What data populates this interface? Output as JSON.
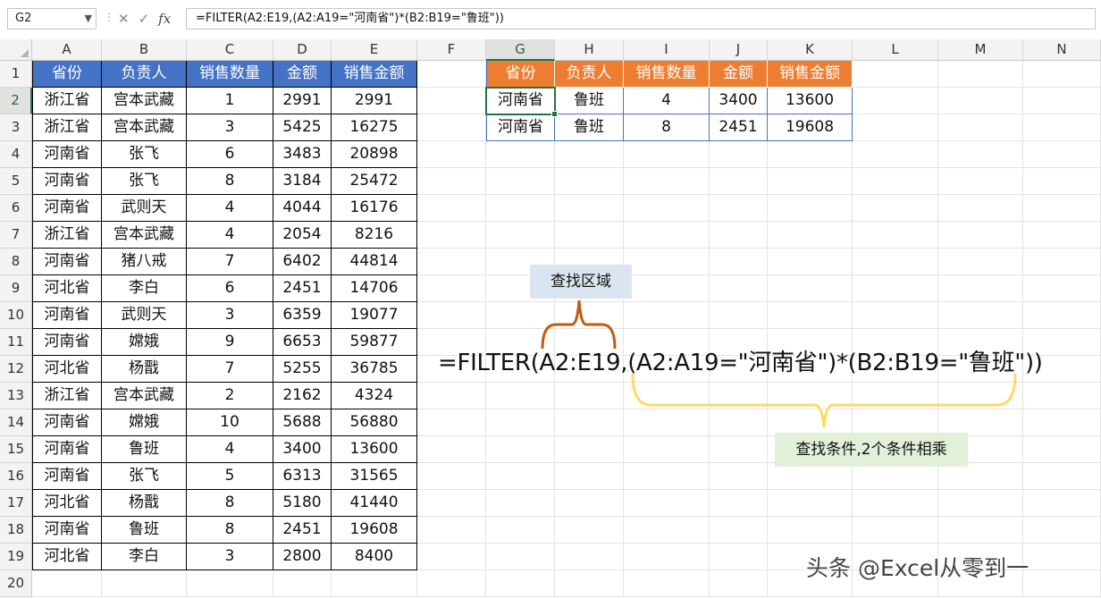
{
  "formula_bar": {
    "name_box": "G2",
    "formula": "=FILTER(A2:E19,(A2:A19=\"河南省\")*(B2:B19=\"鲁班\"))",
    "fx_label": "fx",
    "cancel_icon": "close-icon",
    "enter_icon": "check-icon"
  },
  "columns": [
    "A",
    "B",
    "C",
    "D",
    "E",
    "F",
    "G",
    "H",
    "I",
    "J",
    "K",
    "L",
    "M",
    "N"
  ],
  "rows": [
    "1",
    "2",
    "3",
    "4",
    "5",
    "6",
    "7",
    "8",
    "9",
    "10",
    "11",
    "12",
    "13",
    "14",
    "15",
    "16",
    "17",
    "18",
    "19",
    "20"
  ],
  "source_table": {
    "headers": [
      "省份",
      "负责人",
      "销售数量",
      "金额",
      "销售金额"
    ],
    "rows": [
      [
        "浙江省",
        "宫本武藏",
        "1",
        "2991",
        "2991"
      ],
      [
        "浙江省",
        "宫本武藏",
        "3",
        "5425",
        "16275"
      ],
      [
        "河南省",
        "张飞",
        "6",
        "3483",
        "20898"
      ],
      [
        "河南省",
        "张飞",
        "8",
        "3184",
        "25472"
      ],
      [
        "河南省",
        "武则天",
        "4",
        "4044",
        "16176"
      ],
      [
        "浙江省",
        "宫本武藏",
        "4",
        "2054",
        "8216"
      ],
      [
        "河南省",
        "猪八戒",
        "7",
        "6402",
        "44814"
      ],
      [
        "河北省",
        "李白",
        "6",
        "2451",
        "14706"
      ],
      [
        "河南省",
        "武则天",
        "3",
        "6359",
        "19077"
      ],
      [
        "河南省",
        "嫦娥",
        "9",
        "6653",
        "59877"
      ],
      [
        "河北省",
        "杨戬",
        "7",
        "5255",
        "36785"
      ],
      [
        "浙江省",
        "宫本武藏",
        "2",
        "2162",
        "4324"
      ],
      [
        "河南省",
        "嫦娥",
        "10",
        "5688",
        "56880"
      ],
      [
        "河南省",
        "鲁班",
        "4",
        "3400",
        "13600"
      ],
      [
        "河南省",
        "张飞",
        "5",
        "6313",
        "31565"
      ],
      [
        "河北省",
        "杨戬",
        "8",
        "5180",
        "41440"
      ],
      [
        "河南省",
        "鲁班",
        "8",
        "2451",
        "19608"
      ],
      [
        "河北省",
        "李白",
        "3",
        "2800",
        "8400"
      ]
    ]
  },
  "result_table": {
    "headers": [
      "省份",
      "负责人",
      "销售数量",
      "金额",
      "销售金额"
    ],
    "rows": [
      [
        "河南省",
        "鲁班",
        "4",
        "3400",
        "13600"
      ],
      [
        "河南省",
        "鲁班",
        "8",
        "2451",
        "19608"
      ]
    ]
  },
  "annotations": {
    "lookup_range_label": "查找区域",
    "big_formula": "=FILTER(A2:E19,(A2:A19=\"河南省\")*(B2:B19=\"鲁班\"))",
    "criteria_label": "查找条件,2个条件相乘",
    "watermark": "头条 @Excel从零到一"
  },
  "colors": {
    "source_header_bg": "#4472c4",
    "result_header_bg": "#ed7d31",
    "brace_range": "#c55a11",
    "brace_criteria": "#ffd966",
    "selection": "#217346"
  }
}
